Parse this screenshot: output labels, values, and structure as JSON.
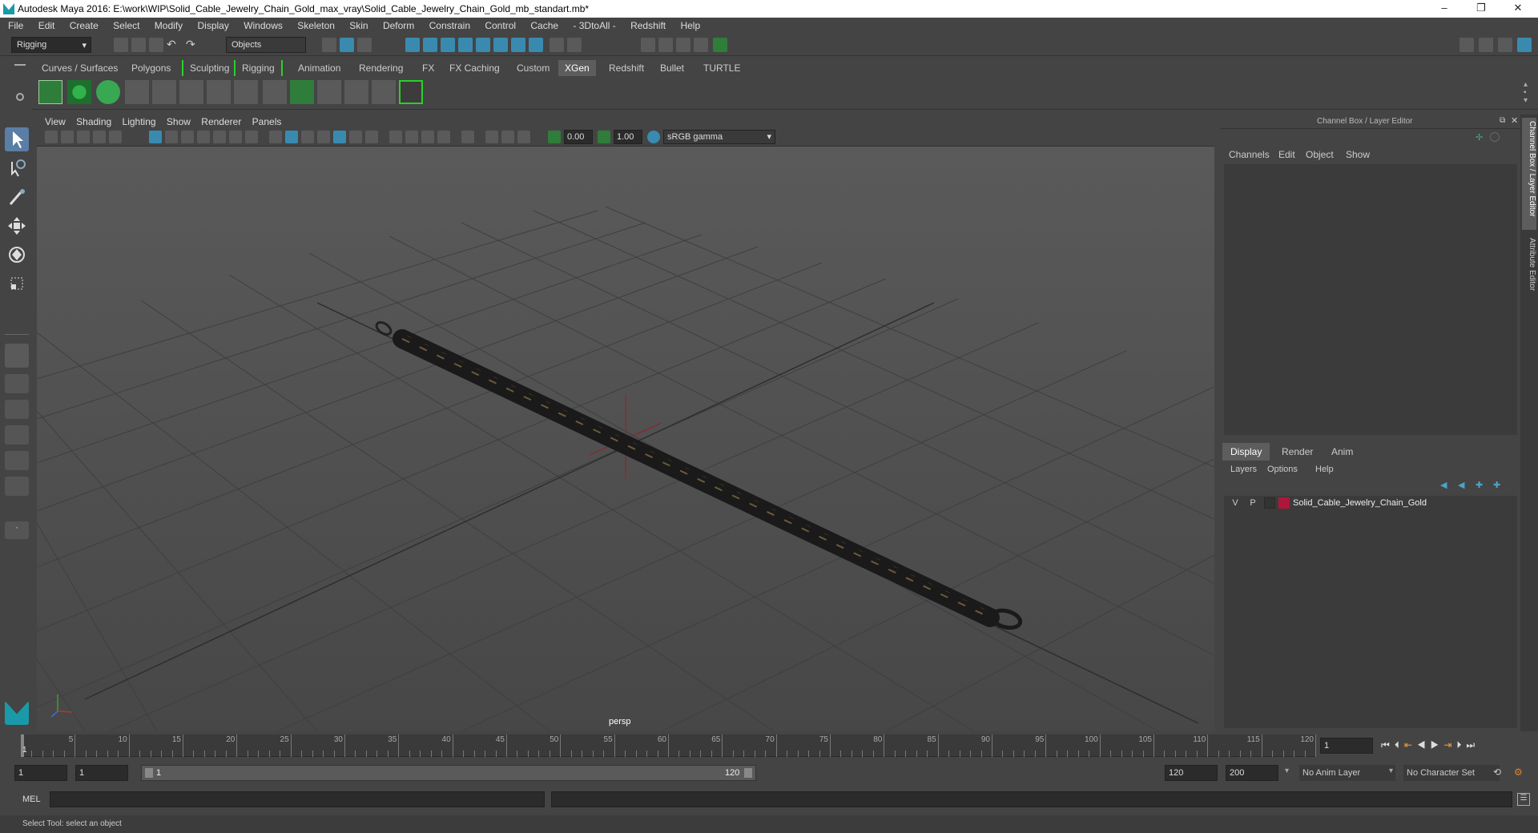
{
  "window": {
    "title": "Autodesk Maya 2016: E:\\work\\WIP\\Solid_Cable_Jewelry_Chain_Gold_max_vray\\Solid_Cable_Jewelry_Chain_Gold_mb_standart.mb*",
    "minimize": "–",
    "maximize": "❐",
    "close": "✕"
  },
  "menubar": [
    "File",
    "Edit",
    "Create",
    "Select",
    "Modify",
    "Display",
    "Windows",
    "Skeleton",
    "Skin",
    "Deform",
    "Constrain",
    "Control",
    "Cache",
    "- 3DtoAll -",
    "Redshift",
    "Help"
  ],
  "status": {
    "mode": "Rigging",
    "selection_mode": "Objects"
  },
  "shelf": {
    "tabs": [
      "Curves / Surfaces",
      "Polygons",
      "Sculpting",
      "Rigging",
      "Animation",
      "Rendering",
      "FX",
      "FX Caching",
      "Custom",
      "XGen",
      "Redshift",
      "Bullet",
      "TURTLE"
    ],
    "active_tab": "XGen"
  },
  "viewport": {
    "menus": [
      "View",
      "Shading",
      "Lighting",
      "Show",
      "Renderer",
      "Panels"
    ],
    "exposure": "0.00",
    "gamma": "1.00",
    "color_space": "sRGB gamma",
    "camera_label": "persp"
  },
  "channel_box": {
    "title": "Channel Box / Layer Editor",
    "menus": [
      "Channels",
      "Edit",
      "Object",
      "Show"
    ],
    "side_tabs": [
      "Channel Box / Layer Editor",
      "Attribute Editor"
    ]
  },
  "layer_editor": {
    "tabs": [
      "Display",
      "Render",
      "Anim"
    ],
    "active_tab": "Display",
    "menus": [
      "Layers",
      "Options",
      "Help"
    ],
    "layers": [
      {
        "visible": "V",
        "playback": "P",
        "color": "#b0163a",
        "name": "Solid_Cable_Jewelry_Chain_Gold"
      }
    ]
  },
  "timeline": {
    "ticks": [
      "5",
      "10",
      "15",
      "20",
      "25",
      "30",
      "35",
      "40",
      "45",
      "50",
      "55",
      "60",
      "65",
      "70",
      "75",
      "80",
      "85",
      "90",
      "95",
      "100",
      "105",
      "110",
      "115",
      "120"
    ],
    "start_label": "1",
    "current_frame": "1"
  },
  "range": {
    "start": "1",
    "playback_start": "1",
    "slider_start": "1",
    "slider_end": "120",
    "playback_end": "120",
    "end": "200",
    "anim_layer": "No Anim Layer",
    "character_set": "No Character Set"
  },
  "command": {
    "language": "MEL",
    "help_text": "Select Tool: select an object"
  }
}
